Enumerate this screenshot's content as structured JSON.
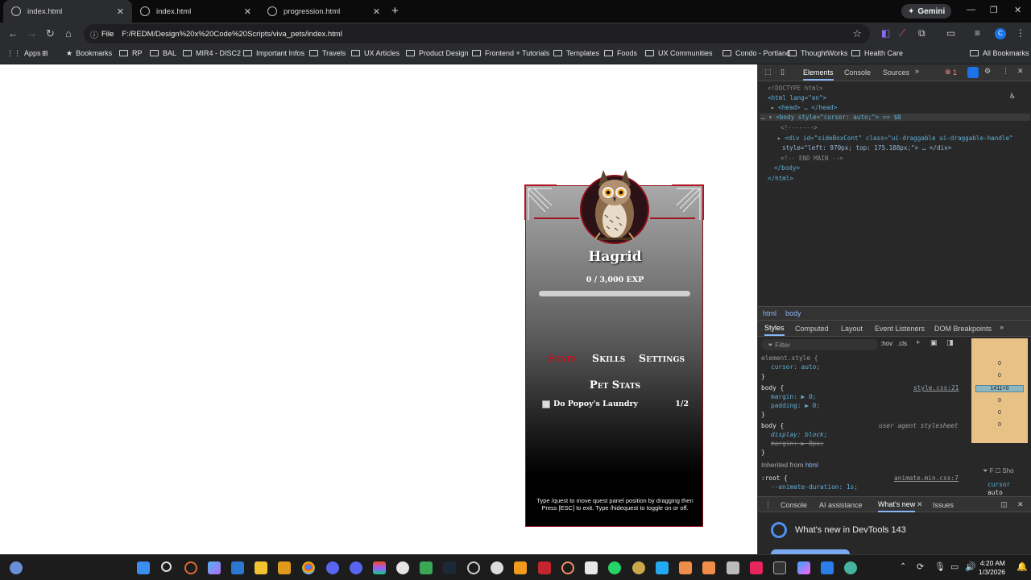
{
  "browser": {
    "tabs": [
      {
        "title": "index.html",
        "active": true
      },
      {
        "title": "index.html",
        "active": false
      },
      {
        "title": "progression.html",
        "active": false
      }
    ],
    "gemini_label": "Gemini",
    "address": {
      "chip": "File",
      "url": "F:/REDM/Design%20x%20Code%20Scripts/viva_pets/index.html"
    },
    "bookmarks": [
      "Apps",
      "Bookmarks",
      "RP",
      "BAL",
      "MIR4 - DISC2",
      "Important Infos",
      "Travels",
      "UX Articles",
      "Product Design",
      "Frontend + Tutorials",
      "Templates",
      "Foods",
      "UX Communities",
      "Condo - Portland",
      "ThoughtWorks",
      "Health Care"
    ],
    "all_bookmarks": "All Bookmarks"
  },
  "panel": {
    "pet_name": "Hagrid",
    "exp_text": "0 / 3,000 EXP",
    "exp_progress": 0,
    "tabs": {
      "stats": "Stats",
      "skills": "Skills",
      "settings": "Settings"
    },
    "section_title": "Pet Stats",
    "quest": {
      "name": "Do Popoy's Laundry",
      "count": "1/2"
    },
    "help_text": "Type /quest to move quest panel position by dragging then Press [ESC] to exit. Type /hidequest to toggle on or off."
  },
  "devtools": {
    "tabs": [
      "Elements",
      "Console",
      "Sources"
    ],
    "error_count": "1",
    "dom": {
      "doctype": "<!DOCTYPE html>",
      "html_open": "<html lang=\"en\">",
      "head": "<head> … </head>",
      "body_open": "<body style=\"cursor: auto;\"> == $0",
      "comment1": "<!------->",
      "div_line1": "<div id=\"sideBoxCont\" class=\"ui-draggable ui-draggable-handle\"",
      "div_line2": "style=\"left: 970px; top: 175.188px;\"> … </div>",
      "comment2": "<!-- END MAIN -->",
      "body_close": "</body>",
      "html_close": "</html>"
    },
    "breadcrumbs": [
      "html",
      "body"
    ],
    "style_tabs": [
      "Styles",
      "Computed",
      "Layout",
      "Event Listeners",
      "DOM Breakpoints"
    ],
    "filter_placeholder": "Filter",
    "filter_tools": [
      ":hov",
      ".cls"
    ],
    "rules": {
      "element_style": "element.style {",
      "cursor": "cursor: auto;",
      "body1_sel": "body {",
      "body1_src": "style.css:21",
      "margin": "margin: ▶ 0;",
      "padding": "padding: ▶ 0;",
      "body2_sel": "body {",
      "body2_src": "user agent stylesheet",
      "display": "display: block;",
      "margin_struck": "margin: ▶ 8px;",
      "inherited": "Inherited from",
      "inherited_el": "html",
      "root_sel": ":root {",
      "root_src": "animate.min.css:7",
      "root_var": "--animate-duration: 1s;"
    },
    "boxmodel": {
      "v1": "0",
      "v2": "0",
      "size": "1411×0",
      "v3": "0",
      "v4": "0",
      "v5": "0"
    },
    "drawer_tabs": [
      "Console",
      "AI assistance",
      "What's new",
      "Issues"
    ],
    "whatsnew": "What's new in DevTools 143",
    "side": {
      "label": "Sho",
      "prop": "cursor",
      "val": "auto"
    }
  },
  "taskbar": {
    "time": "4:20 AM",
    "date": "1/3/2026"
  }
}
